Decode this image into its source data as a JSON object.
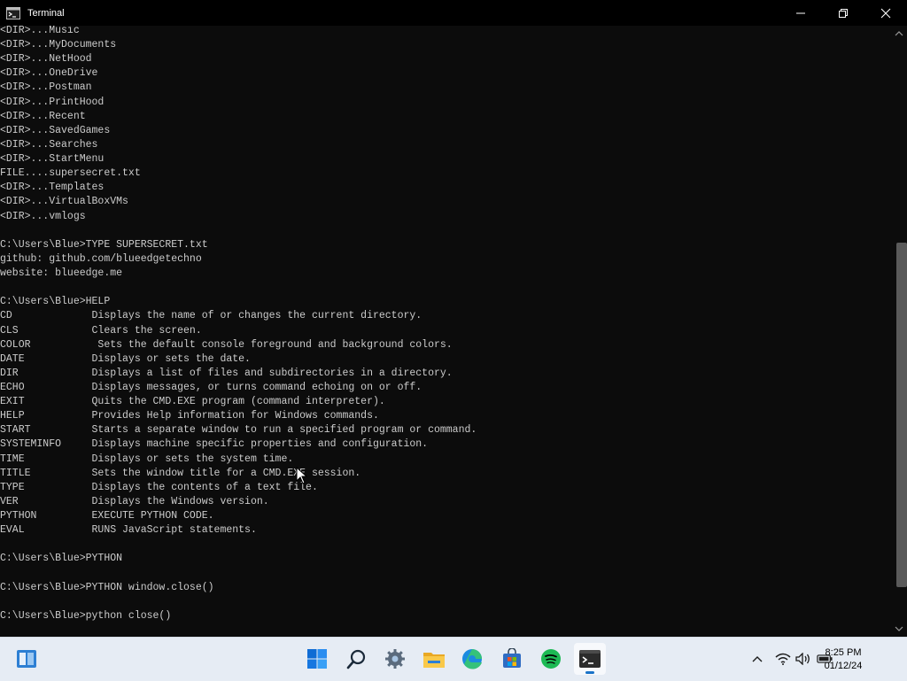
{
  "window": {
    "title": "Terminal"
  },
  "console": {
    "lines": [
      "<DIR>...Music",
      "<DIR>...MyDocuments",
      "<DIR>...NetHood",
      "<DIR>...OneDrive",
      "<DIR>...Postman",
      "<DIR>...PrintHood",
      "<DIR>...Recent",
      "<DIR>...SavedGames",
      "<DIR>...Searches",
      "<DIR>...StartMenu",
      "FILE....supersecret.txt",
      "<DIR>...Templates",
      "<DIR>...VirtualBoxVMs",
      "<DIR>...vmlogs",
      "",
      "C:\\Users\\Blue>TYPE SUPERSECRET.txt",
      "github: github.com/blueedgetechno",
      "website: blueedge.me",
      "",
      "C:\\Users\\Blue>HELP",
      "CD             Displays the name of or changes the current directory.",
      "CLS            Clears the screen.",
      "COLOR           Sets the default console foreground and background colors.",
      "DATE           Displays or sets the date.",
      "DIR            Displays a list of files and subdirectories in a directory.",
      "ECHO           Displays messages, or turns command echoing on or off.",
      "EXIT           Quits the CMD.EXE program (command interpreter).",
      "HELP           Provides Help information for Windows commands.",
      "START          Starts a separate window to run a specified program or command.",
      "SYSTEMINFO     Displays machine specific properties and configuration.",
      "TIME           Displays or sets the system time.",
      "TITLE          Sets the window title for a CMD.EXE session.",
      "TYPE           Displays the contents of a text file.",
      "VER            Displays the Windows version.",
      "PYTHON         EXECUTE PYTHON CODE.",
      "EVAL           RUNS JavaScript statements.",
      "",
      "C:\\Users\\Blue>PYTHON",
      "",
      "C:\\Users\\Blue>PYTHON window.close()",
      "",
      "C:\\Users\\Blue>python close()"
    ]
  },
  "taskbar": {
    "apps": [
      {
        "icon": "widgets-icon"
      },
      {
        "icon": "start-icon"
      },
      {
        "icon": "search-icon"
      },
      {
        "icon": "settings-icon"
      },
      {
        "icon": "file-explorer-icon"
      },
      {
        "icon": "edge-icon"
      },
      {
        "icon": "store-icon"
      },
      {
        "icon": "spotify-icon"
      },
      {
        "icon": "terminal-icon"
      }
    ],
    "active_app": "terminal-icon",
    "clock": {
      "time": "8:25 PM",
      "date": "01/12/24"
    }
  },
  "colors": {
    "console_bg": "#0c0c0c",
    "console_fg": "#cccccc",
    "taskbar_bg": "#e6ecf4",
    "accent": "#1a73c8"
  }
}
